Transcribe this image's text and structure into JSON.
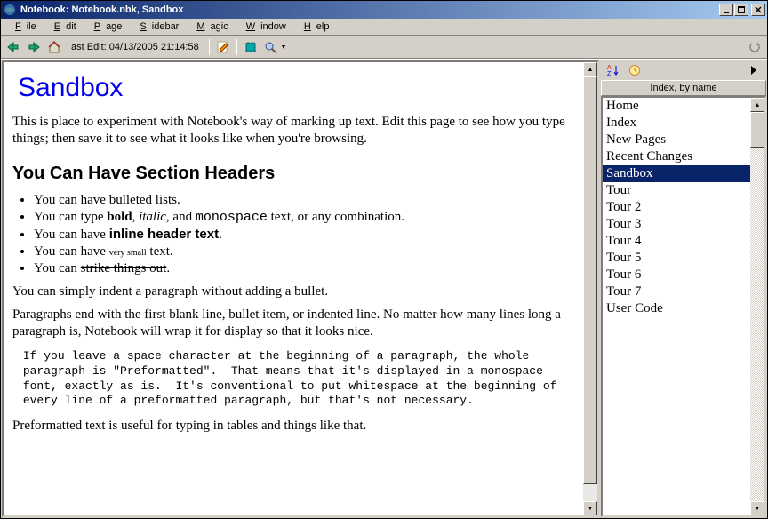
{
  "title": "Notebook: Notebook.nbk, Sandbox",
  "menu": [
    "File",
    "Edit",
    "Page",
    "Sidebar",
    "Magic",
    "Window",
    "Help"
  ],
  "toolbar": {
    "edit_text": "ast Edit: 04/13/2005 21:14:58"
  },
  "content": {
    "h1": "Sandbox",
    "intro": "This is place to experiment with Notebook's way of marking up text. Edit this page to see how you type things; then save it to see what it looks like when you're browsing.",
    "h2": "You Can Have Section Headers",
    "li1": "You can have bulleted lists.",
    "li2a": "You can type ",
    "li2b": "bold",
    "li2c": ", ",
    "li2d": "italic",
    "li2e": ", and ",
    "li2f": "monospace",
    "li2g": " text, or any combination.",
    "li3a": "You can have ",
    "li3b": "inline header text",
    "li3c": ".",
    "li4a": "You can have ",
    "li4b": "very small",
    "li4c": " text.",
    "li5a": "You can ",
    "li5b": "strike things out",
    "li5c": ".",
    "indent": "You can simply indent a paragraph without adding a bullet.",
    "para2": "Paragraphs end with the first blank line, bullet item, or indented line. No matter how many lines long a paragraph is, Notebook will wrap it for display so that it looks nice.",
    "pre": " If you leave a space character at the beginning of a paragraph, the whole\n paragraph is \"Preformatted\".  That means that it's displayed in a monospace\n font, exactly as is.  It's conventional to put whitespace at the beginning of\n every line of a preformatted paragraph, but that's not necessary.",
    "para3": "Preformatted text is useful for typing in tables and things like that."
  },
  "sidebar": {
    "header": "Index, by name",
    "items": [
      "Home",
      "Index",
      "New Pages",
      "Recent Changes",
      "Sandbox",
      "Tour",
      "Tour 2",
      "Tour 3",
      "Tour 4",
      "Tour 5",
      "Tour 6",
      "Tour 7",
      "User Code"
    ],
    "selected": "Sandbox"
  }
}
